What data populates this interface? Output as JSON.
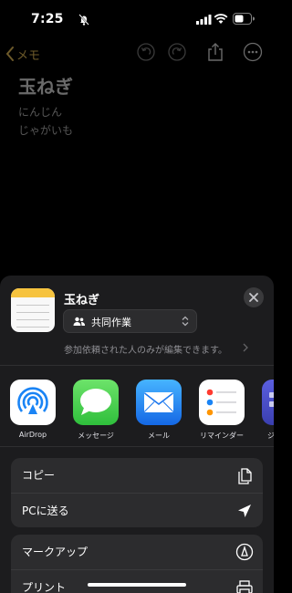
{
  "status_bar": {
    "time": "7:25"
  },
  "note_view": {
    "back_label": "メモ",
    "title": "玉ねぎ",
    "lines": [
      "にんじん",
      "じゃがいも"
    ]
  },
  "share_sheet": {
    "note_title": "玉ねぎ",
    "collab_option": "共同作業",
    "permission_text": "参加依頼された人のみが編集できます。",
    "apps": [
      {
        "label": "AirDrop",
        "icon": "airdrop-icon"
      },
      {
        "label": "メッセージ",
        "icon": "messages-icon"
      },
      {
        "label": "メール",
        "icon": "mail-icon"
      },
      {
        "label": "リマインダー",
        "icon": "reminders-icon"
      },
      {
        "label": "ジ",
        "icon": "app-icon"
      }
    ],
    "actions_group1": [
      {
        "label": "コピー",
        "icon": "copy-icon"
      },
      {
        "label": "PCに送る",
        "icon": "send-arrow-icon"
      }
    ],
    "actions_group2": [
      {
        "label": "マークアップ",
        "icon": "markup-icon"
      },
      {
        "label": "プリント",
        "icon": "printer-icon"
      }
    ]
  },
  "colors": {
    "accent": "#e5a83d",
    "sheet_bg": "#1c1c1e",
    "row_bg": "#2c2c2e"
  }
}
